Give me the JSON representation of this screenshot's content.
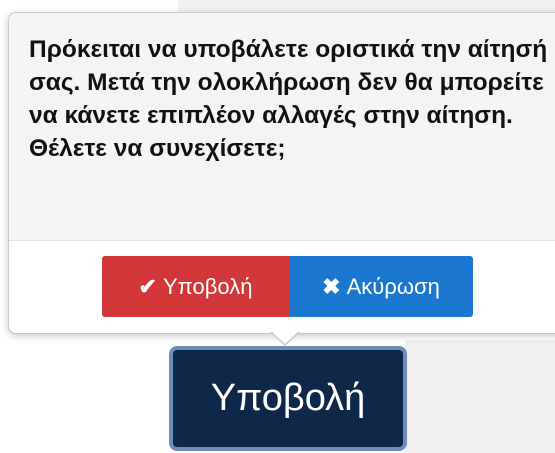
{
  "confirm_popover": {
    "message": "Πρόκειται να υποβάλετε οριστικά την αίτησή σας. Μετά την ολοκλήρωση δεν θα μπορείτε να κάνετε επιπλέον αλλαγές στην αίτηση. Θέλετε να συνεχίσετε;",
    "confirm_button": {
      "icon": "check-icon",
      "icon_glyph": "✔",
      "label": "Υποβολή",
      "color": "#d2373a"
    },
    "cancel_button": {
      "icon": "close-icon",
      "icon_glyph": "✖",
      "label": "Ακύρωση",
      "color": "#1b77cf"
    }
  },
  "submit_button": {
    "label": "Υποβολή",
    "color": "#0f2748",
    "border_color": "#6d8cba"
  }
}
